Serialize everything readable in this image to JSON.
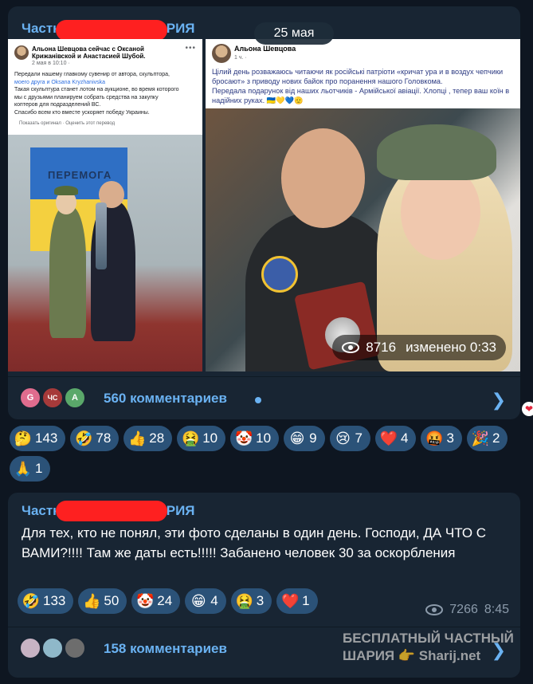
{
  "date_pill": "25 мая",
  "post1": {
    "channel_visible_left": "Частн",
    "channel_visible_right": "АРИЯ",
    "fb_left": {
      "name_line": "Альона Шевцова сейчас с Оксаной Крижанівской и Анастасией Шубой.",
      "meta": "2 мая в 10:10 ·",
      "text_lines": [
        "Передали нашему главкому сувенир от автора, скульптора,",
        "моего друга и Oksana Kryzhanivska",
        "Такая скульптура станет лотом на аукционе, во время которого",
        "мы с друзьями планируем собрать средства на закупку",
        "коптеров для подразделений ВС.",
        "Спасибо всем кто вместе ускоряет победу Украины."
      ],
      "translate": "Показать оригинал · Оценить этот перевод",
      "flag_text": "ПЕРЕМОГА"
    },
    "fb_right": {
      "name": "Альона Шевцова",
      "meta": "1 ч. ·",
      "text_lines": [
        "Цілий день розважаюсь читаючи як  російські патріоти «кричат ура и в воздух чепчики",
        "бросают» з приводу нових байок про поранення нашого Головкома.",
        "Передала подарунок від наших льотчиків - Армійської авіації. Хлопці , тепер ваш коїн в",
        "надійних руках. 🇺🇦💛💙🫡"
      ]
    },
    "views": "8716",
    "edited": "изменено 0:33",
    "comment_avatars": [
      "G",
      "ЧС",
      "A"
    ],
    "comments_label": "560 комментариев",
    "reactions": [
      {
        "emoji": "🤔",
        "count": "143"
      },
      {
        "emoji": "🤣",
        "count": "78"
      },
      {
        "emoji": "👍",
        "count": "28"
      },
      {
        "emoji": "🤮",
        "count": "10"
      },
      {
        "emoji": "🤡",
        "count": "10"
      },
      {
        "emoji": "😁",
        "count": "9"
      },
      {
        "emoji": "😢",
        "count": "7"
      },
      {
        "emoji": "❤️",
        "count": "4"
      },
      {
        "emoji": "🤬",
        "count": "3"
      },
      {
        "emoji": "🎉",
        "count": "2"
      },
      {
        "emoji": "🙏",
        "count": "1"
      }
    ]
  },
  "post2": {
    "channel_visible_left": "Частн",
    "channel_visible_right": "АРИЯ",
    "text": "Для тех, кто не понял, эти фото сделаны в один день. Господи, ДА ЧТО С ВАМИ?!!!! Там же даты есть!!!!! Забанено человек 30 за оскорбления",
    "reactions": [
      {
        "emoji": "🤣",
        "count": "133"
      },
      {
        "emoji": "👍",
        "count": "50"
      },
      {
        "emoji": "🤡",
        "count": "24"
      },
      {
        "emoji": "😁",
        "count": "4"
      },
      {
        "emoji": "🤮",
        "count": "3"
      },
      {
        "emoji": "❤️",
        "count": "1"
      }
    ],
    "views": "7266",
    "time": "8:45",
    "comments_label": "158 комментариев"
  },
  "watermark": {
    "line1": "БЕСПЛАТНЫЙ ЧАСТНЫЙ",
    "line2": "ШАРИЯ 👉 Sharij.net"
  },
  "colors": {
    "background": "#0e1621",
    "bubble": "#182533",
    "accent": "#6ab2f2",
    "reaction_chip": "#2b5278",
    "redaction": "#fe2020"
  }
}
